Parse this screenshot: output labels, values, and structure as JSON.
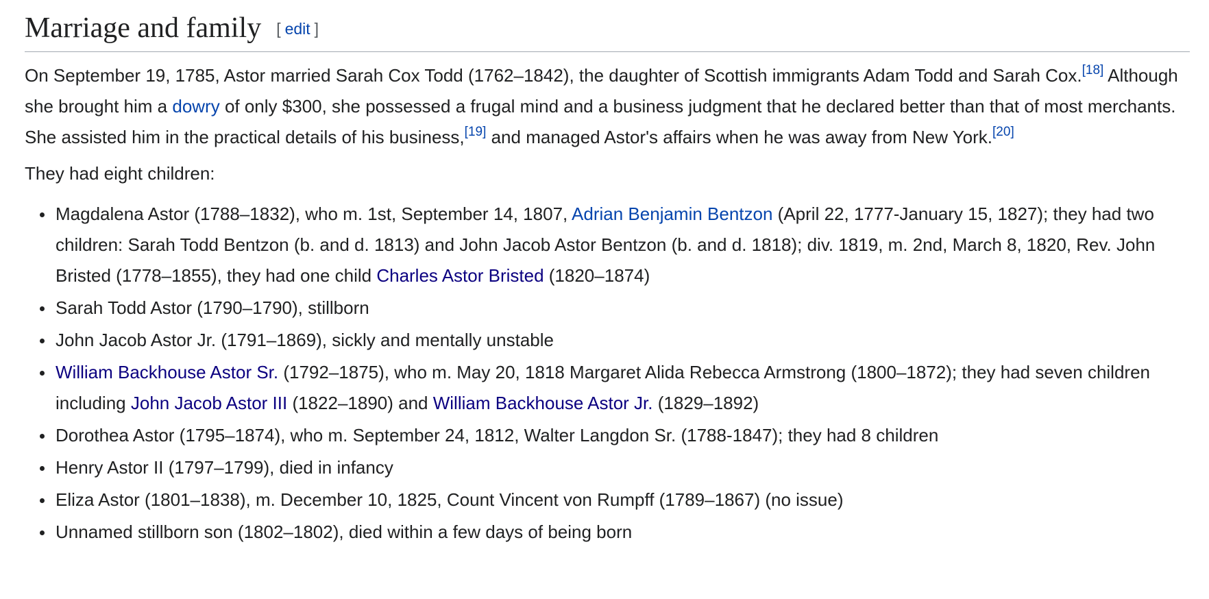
{
  "heading": {
    "title": "Marriage and family",
    "edit_open": "[",
    "edit_label": "edit",
    "edit_close": "]"
  },
  "intro": {
    "part1": "On September 19, 1785, Astor married Sarah Cox Todd (1762–1842), the daughter of Scottish immigrants Adam Todd and Sarah Cox.",
    "ref1": "[18]",
    "part2": " Although she brought him a ",
    "link_dowry": "dowry",
    "part3": " of only $300, she possessed a frugal mind and a business judgment that he declared better than that of most merchants. She assisted him in the practical details of his business,",
    "ref2": "[19]",
    "part4": " and managed Astor's affairs when he was away from New York.",
    "ref3": "[20]"
  },
  "children_intro": "They had eight children:",
  "children": {
    "c1": {
      "t1": "Magdalena Astor (1788–1832), who m. 1st, September 14, 1807, ",
      "link1": "Adrian Benjamin Bentzon",
      "t2": " (April 22, 1777-January 15, 1827); they had two children: Sarah Todd Bentzon (b. and d. 1813) and John Jacob Astor Bentzon (b. and d. 1818); div. 1819, m. 2nd, March 8, 1820, Rev. John Bristed (1778–1855), they had one child ",
      "link2": "Charles Astor Bristed",
      "t3": " (1820–1874)"
    },
    "c2": {
      "t1": "Sarah Todd Astor (1790–1790), stillborn"
    },
    "c3": {
      "t1": "John Jacob Astor Jr. (1791–1869), sickly and mentally unstable"
    },
    "c4": {
      "link1": "William Backhouse Astor Sr.",
      "t1": " (1792–1875), who m. May 20, 1818 Margaret Alida Rebecca Armstrong (1800–1872); they had seven children including ",
      "link2": "John Jacob Astor III",
      "t2": " (1822–1890) and ",
      "link3": "William Backhouse Astor Jr.",
      "t3": " (1829–1892)"
    },
    "c5": {
      "t1": "Dorothea Astor (1795–1874), who m. September 24, 1812, Walter Langdon Sr. (1788-1847); they had 8 children"
    },
    "c6": {
      "t1": "Henry Astor II (1797–1799), died in infancy"
    },
    "c7": {
      "t1": "Eliza Astor (1801–1838), m. December 10, 1825, Count Vincent von Rumpff (1789–1867) (no issue)"
    },
    "c8": {
      "t1": "Unnamed stillborn son (1802–1802), died within a few days of being born"
    }
  },
  "colors": {
    "text": "#202122",
    "link": "#0645ad",
    "visited_link": "#0b0080",
    "rule": "#a2a9b1"
  }
}
